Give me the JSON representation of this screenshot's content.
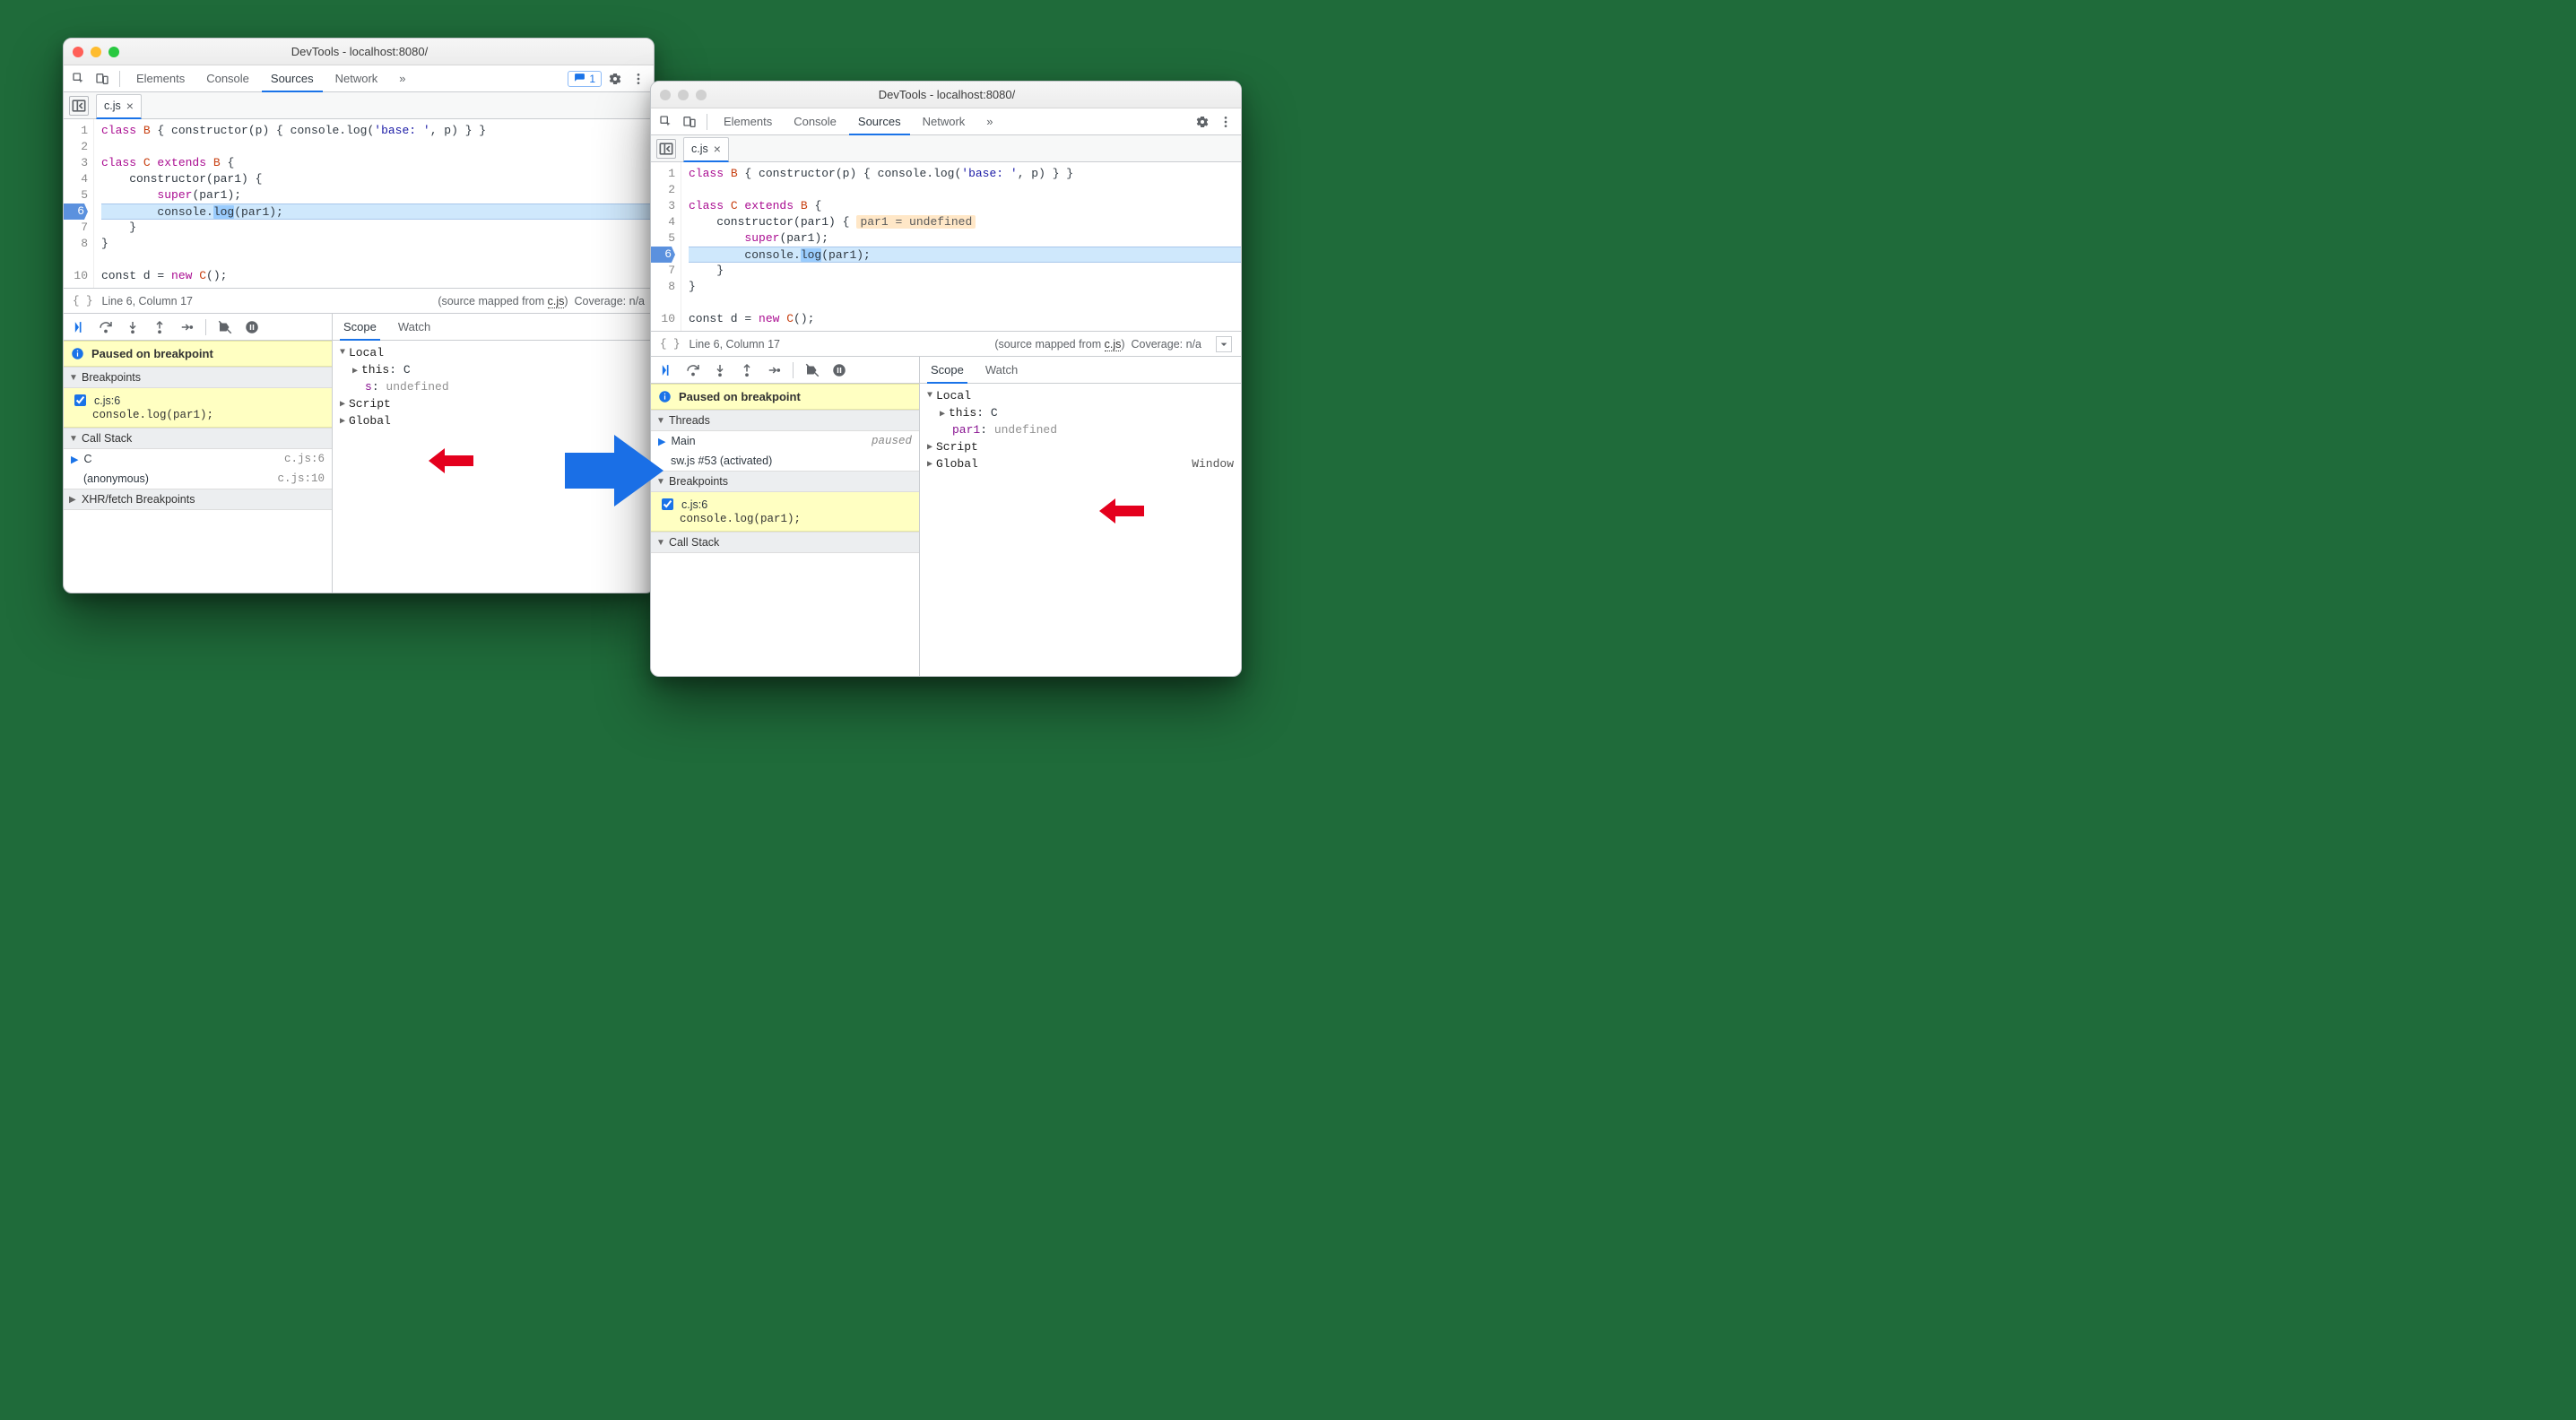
{
  "title": "DevTools - localhost:8080/",
  "tabs": [
    "Elements",
    "Console",
    "Sources",
    "Network"
  ],
  "activeTab": "Sources",
  "moreGlyph": "»",
  "issueCount": "1",
  "file": {
    "name": "c.js"
  },
  "code": {
    "lines": [
      "1",
      "2",
      "3",
      "4",
      "5",
      "6",
      "7",
      "8",
      "",
      "10"
    ],
    "l1": {
      "a": "class ",
      "b": "B",
      "c": " { constructor(p) { console.log(",
      "d": "'base: '",
      "e": ", p) } }"
    },
    "l3": {
      "a": "class ",
      "b": "C",
      "c": " extends ",
      "d": "B",
      "e": " {"
    },
    "l4": "    constructor(par1) {",
    "l4_hint": "par1 = undefined",
    "l5": {
      "a": "        ",
      "b": "super",
      "c": "(par1);"
    },
    "l6": {
      "a": "        console.",
      "b": "log",
      "c": "(par1);"
    },
    "l7": "    }",
    "l8": "}",
    "l10": {
      "a": "const d = ",
      "b": "new",
      "c": " ",
      "d": "C",
      "e": "();"
    }
  },
  "status": {
    "pos": "Line 6, Column 17",
    "mapped_prefix": "(source mapped from ",
    "mapped_link": "c.js",
    "mapped_suffix": ")",
    "coverage_left": "Coverage: n/a",
    "coverage_right": "Coverage: n/a"
  },
  "paused": "Paused on breakpoint",
  "sections": {
    "threads": "Threads",
    "breakpoints": "Breakpoints",
    "callstack": "Call Stack",
    "xhr": "XHR/fetch Breakpoints"
  },
  "threads": {
    "main": "Main",
    "main_state": "paused",
    "sw": "sw.js #53 (activated)"
  },
  "bp": {
    "label": "c.js:6",
    "snippet": "console.log(par1);"
  },
  "stack": {
    "f0": "C",
    "f0_loc": "c.js:6",
    "f1": "(anonymous)",
    "f1_loc": "c.js:10"
  },
  "scope": {
    "tab_scope": "Scope",
    "tab_watch": "Watch",
    "local": "Local",
    "this": "this",
    "this_val": "C",
    "script": "Script",
    "global": "Global",
    "global_val": "Window",
    "left_var": "s",
    "right_var": "par1",
    "undef": "undefined"
  }
}
